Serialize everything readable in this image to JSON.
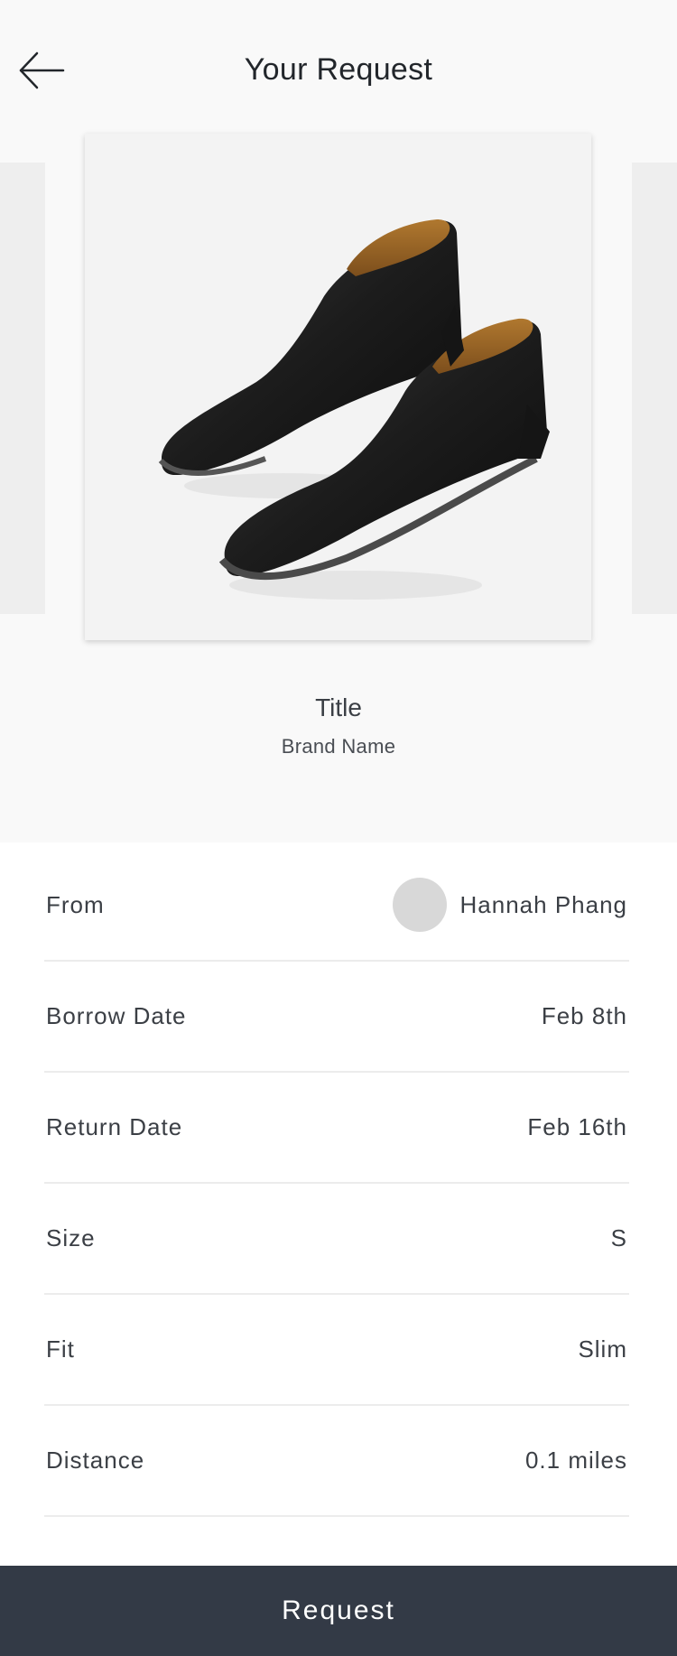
{
  "header": {
    "title": "Your Request",
    "back_icon": "arrow-left-icon"
  },
  "product": {
    "title": "Title",
    "brand": "Brand Name",
    "image": "black-leather-ankle-boots"
  },
  "details": [
    {
      "label": "From",
      "value": "Hannah Phang",
      "has_avatar": true
    },
    {
      "label": "Borrow Date",
      "value": "Feb 8th"
    },
    {
      "label": "Return Date",
      "value": "Feb 16th"
    },
    {
      "label": "Size",
      "value": "S"
    },
    {
      "label": "Fit",
      "value": "Slim"
    },
    {
      "label": "Distance",
      "value": "0.1 miles"
    }
  ],
  "footer": {
    "button_label": "Request"
  },
  "colors": {
    "button_bg": "#333a46",
    "background_top": "#f9f9f9",
    "divider": "#ececec",
    "avatar_placeholder": "#d8d8d8"
  }
}
